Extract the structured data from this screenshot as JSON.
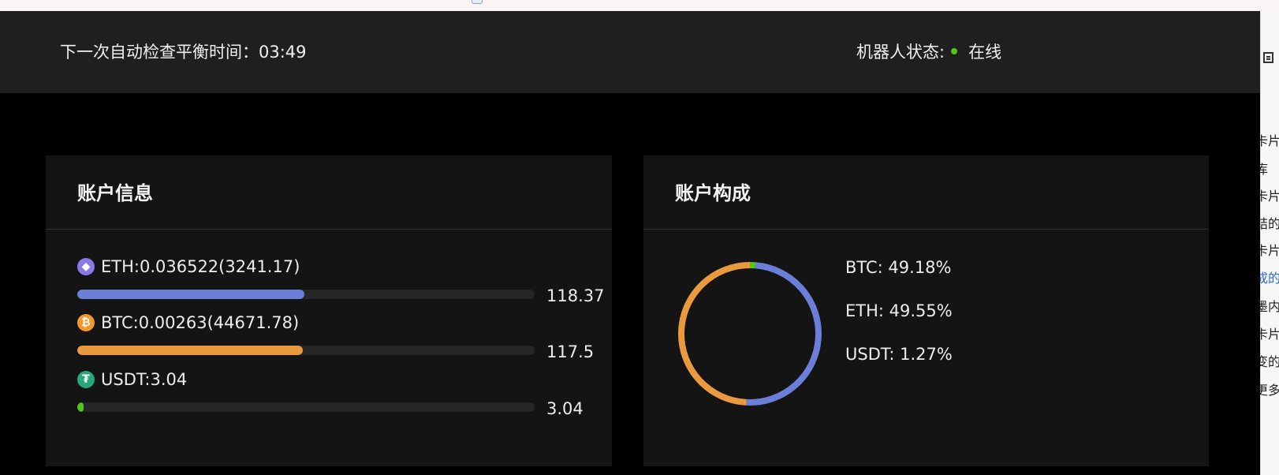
{
  "header": {
    "next_check_label": "下一次自动检查平衡时间：",
    "next_check_time": "03:49",
    "robot_status_label": "机器人状态:",
    "robot_status_value": "在线",
    "status_color": "#52c41a"
  },
  "account_info": {
    "title": "账户信息",
    "assets": [
      {
        "icon": "eth-icon",
        "symbol_glyph": "◆",
        "label": "ETH:0.036522(3241.17)",
        "value": "118.37",
        "fill_fraction": 0.497,
        "color": "#6b7fd9"
      },
      {
        "icon": "btc-icon",
        "symbol_glyph": "₿",
        "label": "BTC:0.00263(44671.78)",
        "value": "117.5",
        "fill_fraction": 0.493,
        "color": "#e99a3e"
      },
      {
        "icon": "usdt-icon",
        "symbol_glyph": "₮",
        "label": "USDT:3.04",
        "value": "3.04",
        "fill_fraction": 0.013,
        "color": "#52c41a"
      }
    ]
  },
  "account_composition": {
    "title": "账户构成",
    "legend": [
      {
        "text": "BTC: 49.18%"
      },
      {
        "text": "ETH: 49.55%"
      },
      {
        "text": "USDT: 1.27%"
      }
    ],
    "chart_data": {
      "type": "pie",
      "categories": [
        "BTC",
        "ETH",
        "USDT"
      ],
      "values": [
        49.18,
        49.55,
        1.27
      ],
      "colors": [
        "#e99a3e",
        "#6b7fd9",
        "#52c41a"
      ],
      "donut": true
    }
  },
  "side_panel": {
    "lines": [
      {
        "text": "卡片"
      },
      {
        "text": "库"
      },
      {
        "text": "卡片"
      },
      {
        "text": "结的"
      },
      {
        "text": "卡片"
      },
      {
        "text": "成的",
        "link": true
      },
      {
        "text": "墨内"
      },
      {
        "text": "卡片"
      },
      {
        "text": "变的"
      },
      {
        "text": "更多"
      }
    ]
  }
}
